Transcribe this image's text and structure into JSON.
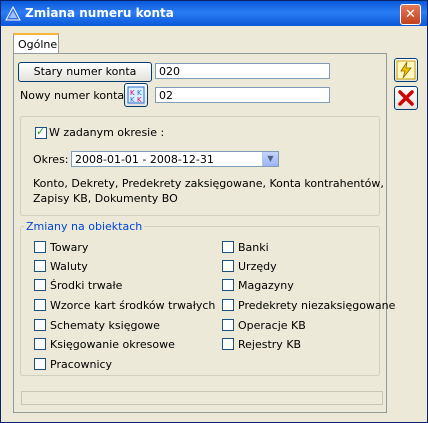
{
  "window": {
    "title": "Zmiana numeru konta",
    "close_label": "✕"
  },
  "tabs": [
    {
      "label": "Ogólne"
    }
  ],
  "main": {
    "stary_button": "Stary numer konta",
    "stary_value": "020",
    "nowy_label": "Nowy numer konta:",
    "nowy_value": "02",
    "period": {
      "checkbox_label": "W zadanym okresie :",
      "checked": true,
      "okres_label": "Okres:",
      "okres_value": "2008-01-01 - 2008-12-31",
      "info_line1": "Konto, Dekrety, Predekrety zaksięgowane, Konta kontrahentów,",
      "info_line2": "Zapisy KB, Dokumenty BO"
    },
    "changes": {
      "title": "Zmiany na obiektach",
      "left": [
        {
          "label": "Towary",
          "checked": false
        },
        {
          "label": "Waluty",
          "checked": false
        },
        {
          "label": "Środki trwałe",
          "checked": false
        },
        {
          "label": "Wzorce kart środków trwałych",
          "checked": false
        },
        {
          "label": "Schematy księgowe",
          "checked": false
        },
        {
          "label": "Księgowanie okresowe",
          "checked": false
        },
        {
          "label": "Pracownicy",
          "checked": false
        }
      ],
      "right": [
        {
          "label": "Banki",
          "checked": false
        },
        {
          "label": "Urzędy",
          "checked": false
        },
        {
          "label": "Magazyny",
          "checked": false
        },
        {
          "label": "Predekrety niezaksięgowane",
          "checked": false
        },
        {
          "label": "Operacje KB",
          "checked": false
        },
        {
          "label": "Rejestry KB",
          "checked": false
        }
      ]
    }
  },
  "side": {
    "execute_icon": "lightning-icon",
    "cancel_icon": "red-x-icon"
  }
}
